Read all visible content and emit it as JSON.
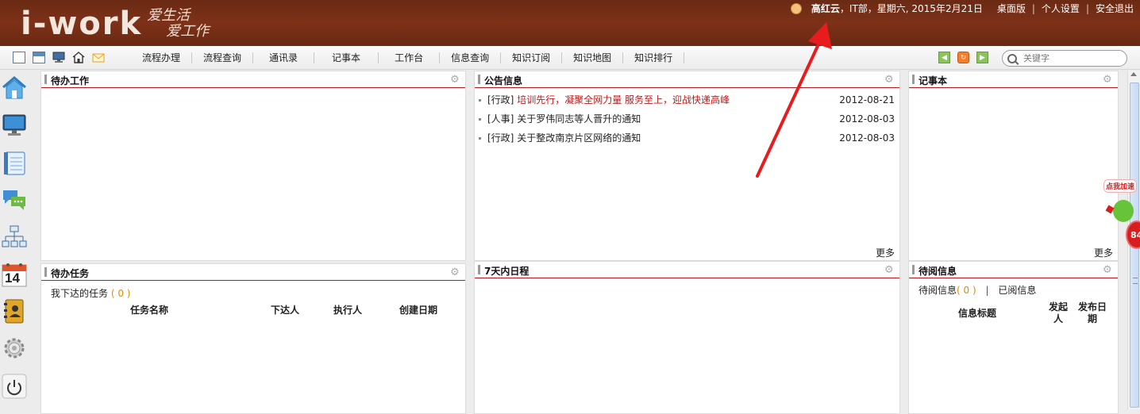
{
  "header": {
    "logo": "i-work",
    "slogan_line1": "爱生活",
    "slogan_line2": "爱工作",
    "user_name": "高红云",
    "user_info": "，IT部，星期六, 2015年2月21日",
    "links": [
      "桌面版",
      "个人设置",
      "安全退出"
    ]
  },
  "toolbar": {
    "icons": [
      "window-icon",
      "layout-icon",
      "monitor-icon",
      "home-icon",
      "mail-icon"
    ],
    "menu": [
      "流程办理",
      "流程查询",
      "通讯录",
      "记事本",
      "工作台",
      "信息查询",
      "知识订阅",
      "知识地图",
      "知识排行"
    ],
    "search_placeholder": "关键字"
  },
  "sidebar": {
    "icons": [
      "home-icon",
      "monitor-icon",
      "notebook-icon",
      "chat-icon",
      "org-chart-icon",
      "calendar-icon",
      "contacts-icon",
      "settings-icon",
      "power-icon"
    ],
    "calendar_day": "14"
  },
  "panels": {
    "todo_work": {
      "title": "待办工作"
    },
    "notices": {
      "title": "公告信息",
      "more": "更多",
      "items": [
        {
          "tag": "[行政]",
          "title": "培训先行，凝聚全网力量 服务至上，迎战快递高峰",
          "date": "2012-08-21",
          "hot": true
        },
        {
          "tag": "[人事]",
          "title": "关于罗伟同志等人晋升的通知",
          "date": "2012-08-03",
          "hot": false
        },
        {
          "tag": "[行政]",
          "title": "关于整改南京片区网络的通知",
          "date": "2012-08-03",
          "hot": false
        }
      ]
    },
    "notebook": {
      "title": "记事本",
      "more": "更多"
    },
    "todo_tasks": {
      "title": "待办任务",
      "sub_label": "我下达的任务",
      "count": "( 0 )",
      "columns": [
        "任务名称",
        "下达人",
        "执行人",
        "创建日期"
      ]
    },
    "schedule": {
      "title": "7天内日程"
    },
    "to_read": {
      "title": "待阅信息",
      "tab_unread": "待阅信息",
      "unread_count": "( 0 )",
      "tab_read": "已阅信息",
      "columns": [
        "信息标题",
        "发起人",
        "发布日期"
      ]
    }
  },
  "float_widget": {
    "label": "点我加速",
    "value": "84"
  },
  "colors": {
    "header_bg": "#7d3118",
    "panel_accent": "#b51a1a",
    "hot_text": "#c01818",
    "count_orange": "#e08a00",
    "arrow": "#e81c1c"
  }
}
